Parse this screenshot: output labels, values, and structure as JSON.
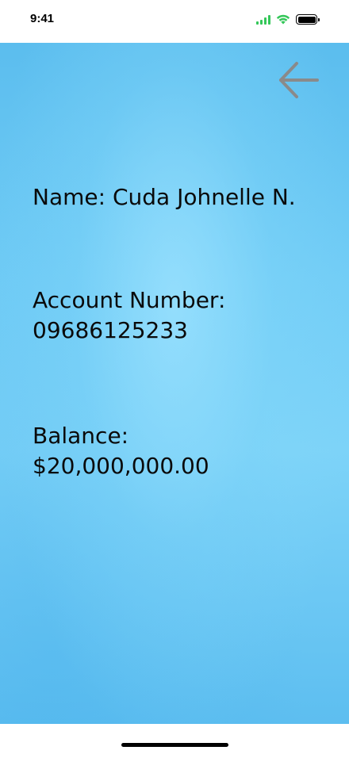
{
  "status_bar": {
    "time": "9:41",
    "signal_color": "#34c759",
    "wifi_color": "#34c759",
    "battery_icon": "battery-icon"
  },
  "header": {
    "back_icon": "arrow-left-icon",
    "back_icon_color": "#8a8a8a"
  },
  "account": {
    "name_line": "Name: Cuda Johnelle N.",
    "account_number_label": "Account Number:",
    "account_number_value": "09686125233",
    "balance_label": "Balance:",
    "balance_value": "$20,000,000.00"
  },
  "theme": {
    "background_color": "#72cdf6",
    "text_color": "#0a0a0a"
  }
}
